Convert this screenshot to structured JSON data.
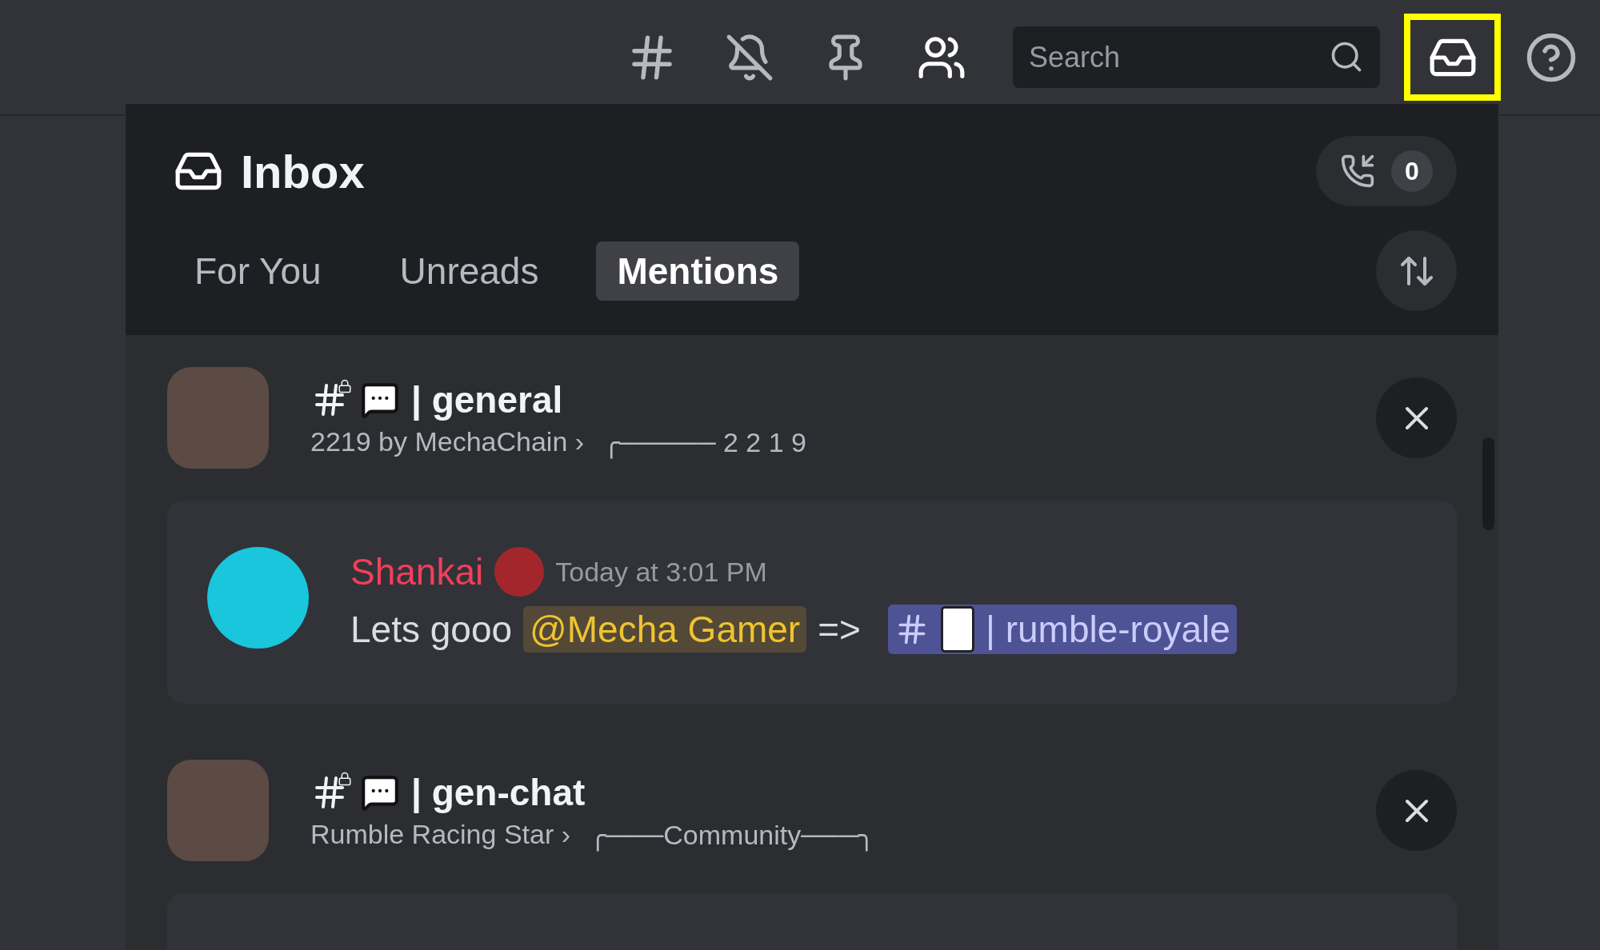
{
  "toolbar": {
    "search": {
      "placeholder": "Search"
    },
    "inbox_button": {
      "highlighted": true
    }
  },
  "inbox": {
    "title": "Inbox",
    "call_count": "0",
    "tabs": [
      {
        "label": "For You",
        "selected": false
      },
      {
        "label": "Unreads",
        "selected": false
      },
      {
        "label": "Mentions",
        "selected": true
      }
    ],
    "items": [
      {
        "channel": "| general",
        "server": "2219 by MechaChain ›",
        "category": "╭───── 2 2 1 9",
        "message": {
          "author": "Shankai",
          "time": "Today at 3:01 PM",
          "parts": [
            {
              "kind": "text",
              "text": "Lets gooo"
            },
            {
              "kind": "mention",
              "text": "@Mecha Gamer"
            },
            {
              "kind": "text",
              "text": "=>"
            },
            {
              "kind": "channel",
              "text": "| rumble-royale"
            }
          ]
        }
      },
      {
        "channel": "| gen-chat",
        "server": "Rumble Racing Star ›",
        "category": "╭───Community───╮"
      }
    ]
  }
}
